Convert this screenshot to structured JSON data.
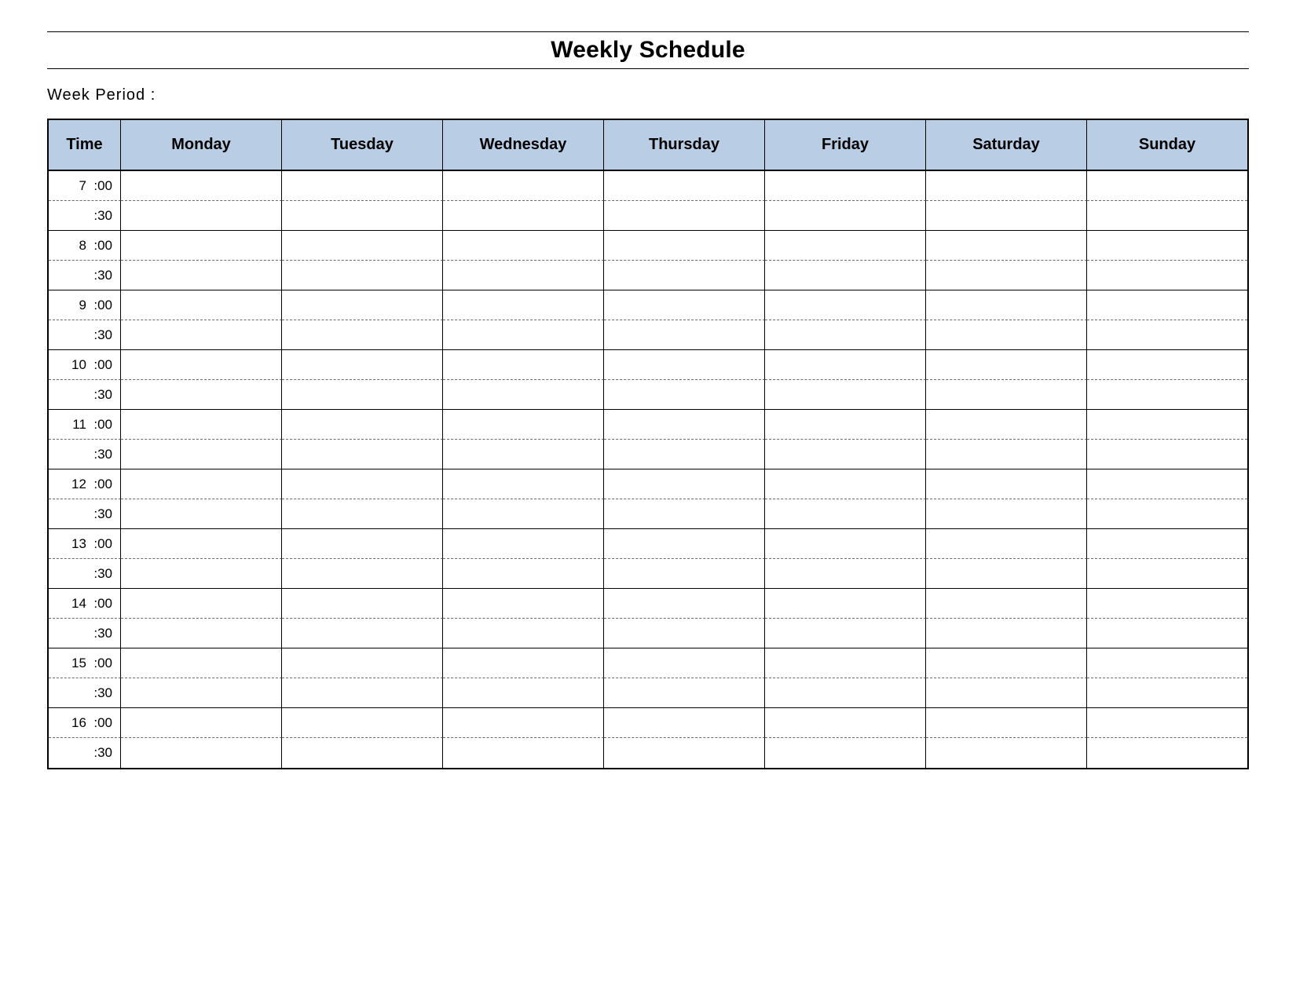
{
  "title": "Weekly Schedule",
  "week_period_label": "Week  Period :",
  "columns": {
    "time": "Time",
    "days": [
      "Monday",
      "Tuesday",
      "Wednesday",
      "Thursday",
      "Friday",
      "Saturday",
      "Sunday"
    ]
  },
  "time_rows": [
    {
      "label": "7  :00",
      "sep": "dash"
    },
    {
      "label": ":30",
      "sep": "solid"
    },
    {
      "label": "8  :00",
      "sep": "dash"
    },
    {
      "label": ":30",
      "sep": "solid"
    },
    {
      "label": "9  :00",
      "sep": "dash"
    },
    {
      "label": ":30",
      "sep": "solid"
    },
    {
      "label": "10  :00",
      "sep": "dash"
    },
    {
      "label": ":30",
      "sep": "solid"
    },
    {
      "label": "11  :00",
      "sep": "dash"
    },
    {
      "label": ":30",
      "sep": "solid"
    },
    {
      "label": "12  :00",
      "sep": "dash"
    },
    {
      "label": ":30",
      "sep": "solid"
    },
    {
      "label": "13  :00",
      "sep": "dash"
    },
    {
      "label": ":30",
      "sep": "solid"
    },
    {
      "label": "14  :00",
      "sep": "dash"
    },
    {
      "label": ":30",
      "sep": "solid"
    },
    {
      "label": "15  :00",
      "sep": "dash"
    },
    {
      "label": ":30",
      "sep": "solid"
    },
    {
      "label": "16  :00",
      "sep": "dash"
    },
    {
      "label": ":30",
      "sep": "none"
    }
  ]
}
